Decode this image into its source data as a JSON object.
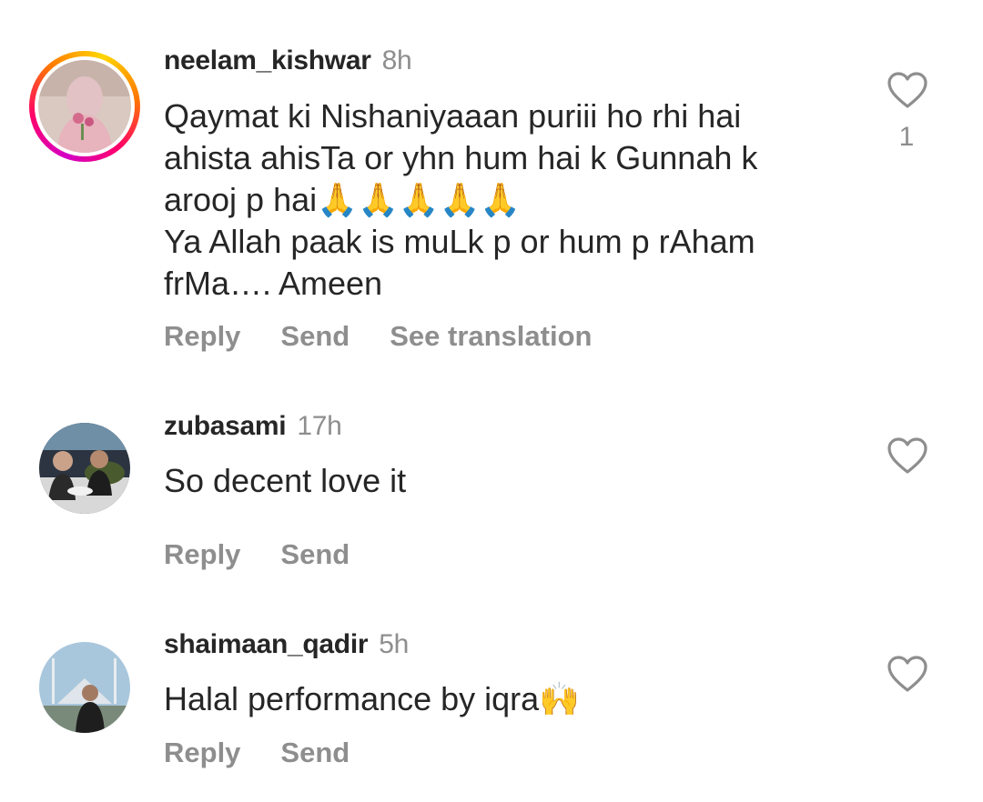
{
  "comments": [
    {
      "username": "neelam_kishwar",
      "time": "8h",
      "text": "Qaymat ki Nishaniyaaan puriii ho rhi hai ahista ahisTa or yhn hum hai k Gunnah k arooj p hai🙏🙏🙏🙏🙏\nYa Allah paak is muLk p or hum p rAham frMa…. Ameen",
      "likes": "1",
      "actions": {
        "reply": "Reply",
        "send": "Send",
        "translate": "See translation"
      },
      "avatar_story_ring": true
    },
    {
      "username": "zubasami",
      "time": "17h",
      "text": "So decent love it",
      "actions": {
        "reply": "Reply",
        "send": "Send"
      }
    },
    {
      "username": "shaimaan_qadir",
      "time": "5h",
      "text": "Halal performance by iqra🙌",
      "actions": {
        "reply": "Reply",
        "send": "Send"
      }
    }
  ],
  "colors": {
    "text": "#262626",
    "muted": "#8e8e8e",
    "icon": "#8e8e8e"
  },
  "icons": {
    "like": "heart-outline-icon"
  }
}
